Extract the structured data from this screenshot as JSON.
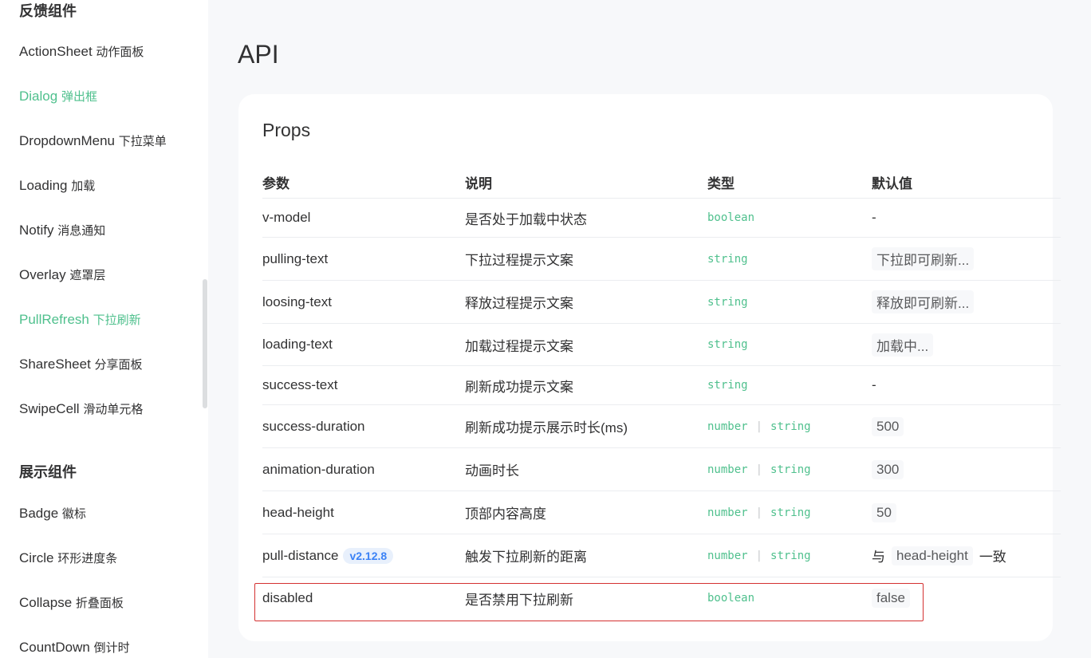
{
  "sidebar": {
    "group1_title": "反馈组件",
    "group1_items": [
      {
        "en": "ActionSheet",
        "zh": "动作面板"
      },
      {
        "en": "Dialog",
        "zh": "弹出框"
      },
      {
        "en": "DropdownMenu",
        "zh": "下拉菜单"
      },
      {
        "en": "Loading",
        "zh": "加载"
      },
      {
        "en": "Notify",
        "zh": "消息通知"
      },
      {
        "en": "Overlay",
        "zh": "遮罩层"
      },
      {
        "en": "PullRefresh",
        "zh": "下拉刷新"
      },
      {
        "en": "ShareSheet",
        "zh": "分享面板"
      },
      {
        "en": "SwipeCell",
        "zh": "滑动单元格"
      }
    ],
    "group2_title": "展示组件",
    "group2_items": [
      {
        "en": "Badge",
        "zh": "徽标"
      },
      {
        "en": "Circle",
        "zh": "环形进度条"
      },
      {
        "en": "Collapse",
        "zh": "折叠面板"
      },
      {
        "en": "CountDown",
        "zh": "倒计时"
      }
    ]
  },
  "main": {
    "title": "API",
    "card_title": "Props",
    "headers": [
      "参数",
      "说明",
      "类型",
      "默认值"
    ],
    "rows": [
      {
        "name": "v-model",
        "desc": "是否处于加载中状态",
        "type1": "boolean",
        "type2": "",
        "default": "-"
      },
      {
        "name": "pulling-text",
        "desc": "下拉过程提示文案",
        "type1": "string",
        "type2": "",
        "default": "下拉即可刷新..."
      },
      {
        "name": "loosing-text",
        "desc": "释放过程提示文案",
        "type1": "string",
        "type2": "",
        "default": "释放即可刷新..."
      },
      {
        "name": "loading-text",
        "desc": "加载过程提示文案",
        "type1": "string",
        "type2": "",
        "default": "加载中..."
      },
      {
        "name": "success-text",
        "desc": "刷新成功提示文案",
        "type1": "string",
        "type2": "",
        "default": "-"
      },
      {
        "name": "success-duration",
        "desc": "刷新成功提示展示时长(ms)",
        "type1": "number",
        "type2": "string",
        "default": "500"
      },
      {
        "name": "animation-duration",
        "desc": "动画时长",
        "type1": "number",
        "type2": "string",
        "default": "300"
      },
      {
        "name": "head-height",
        "desc": "顶部内容高度",
        "type1": "number",
        "type2": "string",
        "default": "50"
      },
      {
        "name": "pull-distance",
        "badge": "v2.12.8",
        "desc": "触发下拉刷新的距离",
        "type1": "number",
        "type2": "string",
        "default_pre": "与",
        "default": "head-height",
        "default_post": "一致"
      },
      {
        "name": "disabled",
        "desc": "是否禁用下拉刷新",
        "type1": "boolean",
        "type2": "",
        "default": "false"
      }
    ],
    "type_separator": "|"
  },
  "colors": {
    "accent": "#4fc08d",
    "highlight": "#d43030",
    "badge": "#3b82f6"
  }
}
